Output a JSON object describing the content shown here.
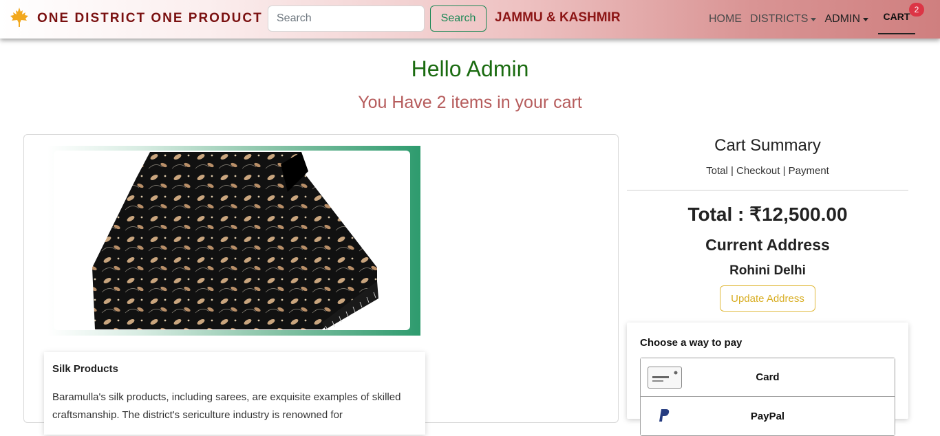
{
  "navbar": {
    "brand": "ONE DISTRICT ONE PRODUCT",
    "brand_icon": "maple-leaf-icon",
    "search_placeholder": "Search",
    "search_button": "Search",
    "state": "JAMMU & KASHMIR",
    "links": {
      "home": "HOME",
      "districts": "DISTRICTS",
      "admin": "ADMIN"
    },
    "cart": "CART",
    "cart_badge": "2"
  },
  "greeting": "Hello Admin",
  "cart_message": "You Have 2 items in your cart",
  "product": {
    "image": "kashmiri-embroidered-shawl",
    "title": "Silk Products",
    "description": "Baramulla's silk products, including sarees, are exquisite examples of skilled craftsmanship. The district's sericulture industry is renowned for"
  },
  "summary": {
    "title": "Cart Summary",
    "steps": "Total | Checkout | Payment",
    "total": "Total : ₹12,500.00",
    "address_heading": "Current Address",
    "address": "Rohini Delhi",
    "update_button": "Update Address"
  },
  "payment": {
    "heading": "Choose a way to pay",
    "options": [
      {
        "label": "Card",
        "icon": "credit-card-icon"
      },
      {
        "label": "PayPal",
        "icon": "paypal-icon"
      }
    ]
  },
  "colors": {
    "brand": "#7a1010",
    "greeting": "#1a6b10",
    "cart_message": "#b65c5c",
    "search_button": "#198754",
    "update_button": "#d8ad22",
    "badge": "#dc3545"
  }
}
